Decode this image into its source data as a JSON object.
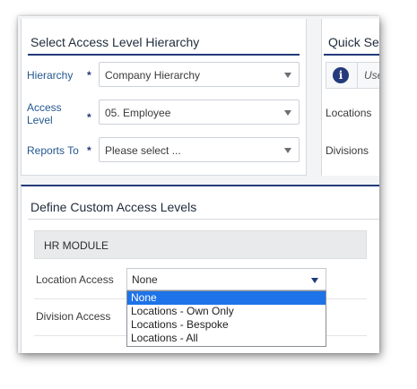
{
  "hierarchy_panel": {
    "title": "Select Access Level Hierarchy",
    "fields": [
      {
        "label": "Hierarchy",
        "required": "*",
        "value": "Company Hierarchy"
      },
      {
        "label": "Access Level",
        "required": "*",
        "value": "05. Employee"
      },
      {
        "label": "Reports To",
        "required": "*",
        "value": "Please select ..."
      }
    ]
  },
  "quick_panel": {
    "title": "Quick Se",
    "info_icon": "info-icon",
    "info_text": "Use",
    "rows": [
      "Locations",
      "Divisions"
    ]
  },
  "custom_panel": {
    "title": "Define Custom Access Levels",
    "module": "HR MODULE",
    "location_access": {
      "label": "Location Access",
      "value": "None",
      "options": [
        "None",
        "Locations - Own Only",
        "Locations - Bespoke",
        "Locations - All"
      ],
      "selected_option": "None"
    },
    "division_access": {
      "label": "Division Access"
    }
  },
  "colors": {
    "accent": "#243a7a",
    "label_blue": "#24588f",
    "option_highlight": "#1e73e8"
  }
}
